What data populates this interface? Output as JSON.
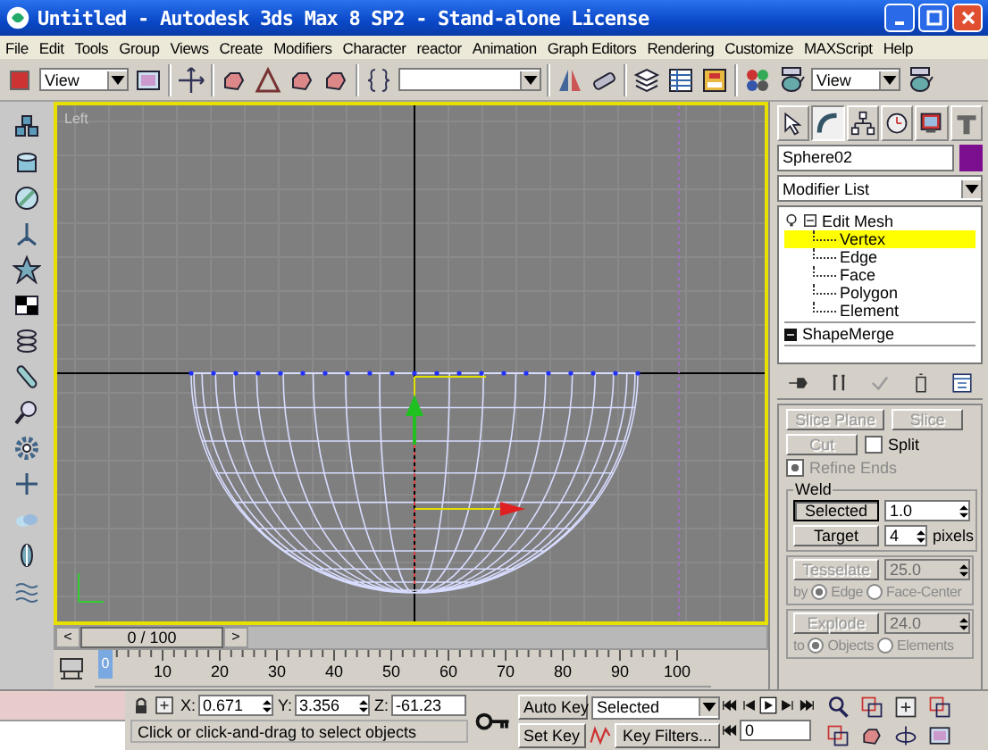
{
  "window": {
    "title": "Untitled  - Autodesk 3ds Max 8 SP2  - Stand-alone License"
  },
  "menu": [
    "File",
    "Edit",
    "Tools",
    "Group",
    "Views",
    "Create",
    "Modifiers",
    "Character",
    "reactor",
    "Animation",
    "Graph Editors",
    "Rendering",
    "Customize",
    "MAXScript",
    "Help"
  ],
  "toolbar": {
    "selection_filter": "View",
    "reference_coordinate": "View"
  },
  "viewport": {
    "label": "Left"
  },
  "command_panel": {
    "tabs": [
      {
        "selected": false
      },
      {
        "selected": true
      },
      {
        "selected": false
      },
      {
        "selected": false
      },
      {
        "selected": false
      },
      {
        "selected": false
      }
    ],
    "object_name": "Sphere02",
    "modifier_list": "Modifier List",
    "stack": [
      {
        "label": "Edit Mesh",
        "kind": "modifier",
        "expanded": true,
        "children": [
          {
            "label": "Vertex",
            "selected": true
          },
          {
            "label": "Edge",
            "selected": false
          },
          {
            "label": "Face",
            "selected": false
          },
          {
            "label": "Polygon",
            "selected": false
          },
          {
            "label": "Element",
            "selected": false
          }
        ]
      },
      {
        "label": "ShapeMerge",
        "kind": "object",
        "expanded": false
      }
    ],
    "rollout": {
      "top_buttons": [
        {
          "label": "Slice Plane",
          "disabled": true
        },
        {
          "label": "Slice",
          "disabled": true
        }
      ],
      "cut": {
        "label": "Cut",
        "disabled": true
      },
      "split": {
        "label": "Split",
        "checked": false
      },
      "refine_ends": {
        "label": "Refine Ends",
        "checked": true,
        "disabled": true
      },
      "weld": {
        "title": "Weld",
        "rows": [
          {
            "button": "Selected",
            "value": "1.0"
          },
          {
            "button": "Target",
            "value": "4",
            "unit": "pixels"
          }
        ]
      },
      "groups": [
        {
          "button": "Tesselate",
          "value": "25.0",
          "disabled": true,
          "prefix": "by",
          "options": [
            {
              "label": "Edge",
              "selected": true
            },
            {
              "label": "Face-Center",
              "selected": false
            }
          ]
        },
        {
          "button": "Explode",
          "value": "24.0",
          "disabled": true,
          "prefix": "to",
          "options": [
            {
              "label": "Objects",
              "selected": true
            },
            {
              "label": "Elements",
              "selected": false
            }
          ]
        }
      ]
    }
  },
  "time_slider": {
    "label": "0 / 100",
    "prev": "<",
    "next": ">"
  },
  "track_bar": {
    "marker": "0",
    "ticks": [
      "10",
      "20",
      "30",
      "40",
      "50",
      "60",
      "70",
      "80",
      "90",
      "100"
    ]
  },
  "status": {
    "coordinates": [
      {
        "axis": "X:",
        "value": "0.671"
      },
      {
        "axis": "Y:",
        "value": "3.356"
      },
      {
        "axis": "Z:",
        "value": "-61.23"
      }
    ],
    "prompt": "Click or click-and-drag to select objects",
    "auto_key": "Auto Key",
    "key_mode": "Selected",
    "set_key": "Set Key",
    "key_filters": "Key Filters...",
    "current_frame": "0"
  }
}
